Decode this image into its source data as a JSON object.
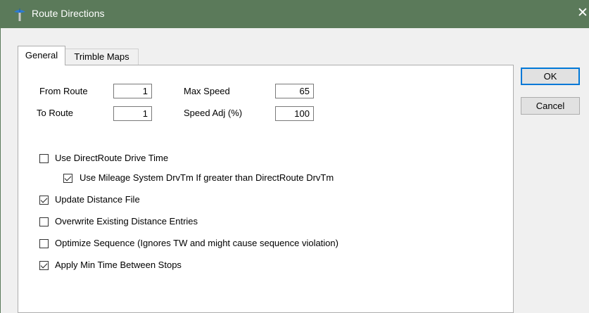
{
  "window": {
    "title": "Route Directions",
    "app_icon": "map-pin-icon",
    "close_glyph": "✕",
    "titlebar_color": "#5b7a5a"
  },
  "tabs": [
    {
      "label": "General",
      "active": true
    },
    {
      "label": "Trimble Maps",
      "active": false
    }
  ],
  "fields": {
    "from_route": {
      "label": "From Route",
      "value": "1"
    },
    "to_route": {
      "label": "To Route",
      "value": "1"
    },
    "max_speed": {
      "label": "Max Speed",
      "value": "65"
    },
    "speed_adj": {
      "label": "Speed Adj (%)",
      "value": "100"
    }
  },
  "options": {
    "use_directroute": {
      "label": "Use DirectRoute Drive Time",
      "checked": false
    },
    "use_mileage": {
      "label": "Use Mileage System DrvTm If greater than DirectRoute DrvTm",
      "checked": true
    },
    "update_distance": {
      "label": "Update Distance File",
      "checked": true
    },
    "overwrite_distance": {
      "label": "Overwrite Existing Distance Entries",
      "checked": false
    },
    "optimize_sequence": {
      "label": "Optimize Sequence (Ignores TW and might cause sequence violation)",
      "checked": false
    },
    "apply_min_time": {
      "label": "Apply Min Time Between Stops",
      "checked": true
    }
  },
  "buttons": {
    "ok": "OK",
    "cancel": "Cancel"
  }
}
